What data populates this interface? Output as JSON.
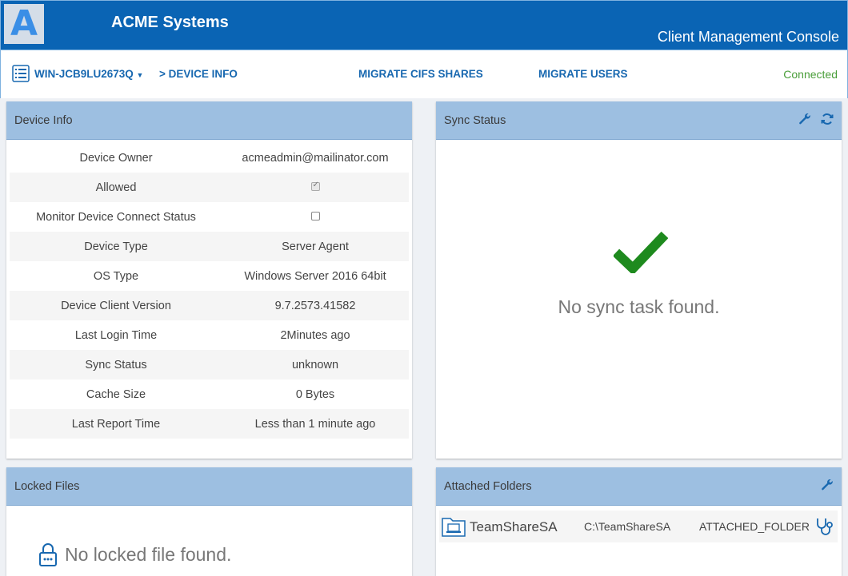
{
  "header": {
    "logo_letter": "A",
    "brand": "ACME Systems",
    "console_title": "Client Management Console"
  },
  "nav": {
    "device_name": "WIN-JCB9LU2673Q",
    "breadcrumb": "> DEVICE INFO",
    "migrate_cifs": "MIGRATE CIFS SHARES",
    "migrate_users": "MIGRATE USERS",
    "status": "Connected"
  },
  "device_info": {
    "title": "Device Info",
    "rows": [
      {
        "label": "Device Owner",
        "value": "acmeadmin@mailinator.com"
      },
      {
        "label": "Allowed",
        "value": ""
      },
      {
        "label": "Monitor Device Connect Status",
        "value": ""
      },
      {
        "label": "Device Type",
        "value": "Server Agent"
      },
      {
        "label": "OS Type",
        "value": "Windows Server 2016 64bit"
      },
      {
        "label": "Device Client Version",
        "value": "9.7.2573.41582"
      },
      {
        "label": "Last Login Time",
        "value": "2Minutes ago"
      },
      {
        "label": "Sync Status",
        "value": "unknown"
      },
      {
        "label": "Cache Size",
        "value": "0 Bytes"
      },
      {
        "label": "Last Report Time",
        "value": "Less than 1 minute ago"
      }
    ],
    "allowed_checked": true,
    "monitor_checked": false
  },
  "sync_status": {
    "title": "Sync Status",
    "message": "No sync task found.",
    "check_color": "#1e8a1e"
  },
  "locked_files": {
    "title": "Locked Files",
    "message": "No locked file found."
  },
  "attached_folders": {
    "title": "Attached Folders",
    "folders": [
      {
        "name": "TeamShareSA",
        "path": "C:\\TeamShareSA",
        "type": "ATTACHED_FOLDER"
      }
    ]
  },
  "icons": {
    "device_list": "list-icon",
    "dropdown": "caret-down-icon",
    "wrench": "wrench-icon",
    "refresh": "refresh-icon",
    "checkmark": "checkmark-icon",
    "lock": "lock-icon",
    "folder": "folder-icon",
    "stethoscope": "stethoscope-icon"
  }
}
